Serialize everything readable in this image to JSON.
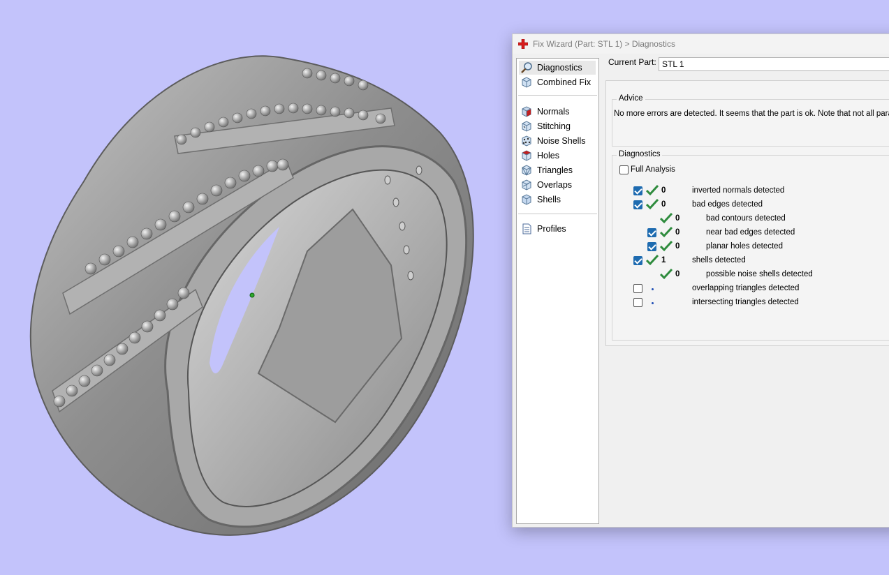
{
  "window": {
    "title": "Fix Wizard (Part: STL 1) > Diagnostics"
  },
  "nav": {
    "items": [
      {
        "label": "Diagnostics",
        "icon": "magnifier-icon",
        "selected": true
      },
      {
        "label": "Combined Fix",
        "icon": "cube-icon"
      },
      {
        "label": "Normals",
        "icon": "normals-cube-icon"
      },
      {
        "label": "Stitching",
        "icon": "stitching-cube-icon"
      },
      {
        "label": "Noise Shells",
        "icon": "noise-shells-icon"
      },
      {
        "label": "Holes",
        "icon": "holes-cube-icon"
      },
      {
        "label": "Triangles",
        "icon": "triangles-cube-icon"
      },
      {
        "label": "Overlaps",
        "icon": "overlaps-cube-icon"
      },
      {
        "label": "Shells",
        "icon": "shells-cube-icon"
      },
      {
        "label": "Profiles",
        "icon": "document-icon"
      }
    ]
  },
  "current_part": {
    "label": "Current Part:",
    "value": "STL 1"
  },
  "advice": {
    "title": "Advice",
    "text": "No more errors are detected. It seems that the part is ok. Note that not all para"
  },
  "diagnostics": {
    "title": "Diagnostics",
    "full_analysis": {
      "label": "Full Analysis",
      "checked": false
    },
    "rows": [
      {
        "checkbox": true,
        "checked": true,
        "status": "ok",
        "count": "0",
        "label": "inverted normals detected",
        "level": 0
      },
      {
        "checkbox": true,
        "checked": true,
        "status": "ok",
        "count": "0",
        "label": "bad edges detected",
        "level": 0
      },
      {
        "checkbox": false,
        "checked": false,
        "status": "ok",
        "count": "0",
        "label": "bad contours detected",
        "level": 1
      },
      {
        "checkbox": true,
        "checked": true,
        "status": "ok",
        "count": "0",
        "label": "near bad edges detected",
        "level": 1
      },
      {
        "checkbox": true,
        "checked": true,
        "status": "ok",
        "count": "0",
        "label": "planar holes detected",
        "level": 1
      },
      {
        "checkbox": true,
        "checked": true,
        "status": "ok",
        "count": "1",
        "label": "shells detected",
        "level": 0
      },
      {
        "checkbox": false,
        "checked": false,
        "status": "ok",
        "count": "0",
        "label": "possible noise shells detected",
        "level": 1
      },
      {
        "checkbox": true,
        "checked": false,
        "status": "pending",
        "count": "",
        "label": "overlapping triangles detected",
        "level": 0
      },
      {
        "checkbox": true,
        "checked": false,
        "status": "pending",
        "count": "",
        "label": "intersecting triangles detected",
        "level": 0
      }
    ]
  },
  "colors": {
    "viewport_bg": "#c3c3fb",
    "model_gray": "#9a9a9a",
    "checkbox_blue": "#1e6bb0",
    "tick_green": "#2e8b3d",
    "app_icon_red": "#d61c1c"
  }
}
